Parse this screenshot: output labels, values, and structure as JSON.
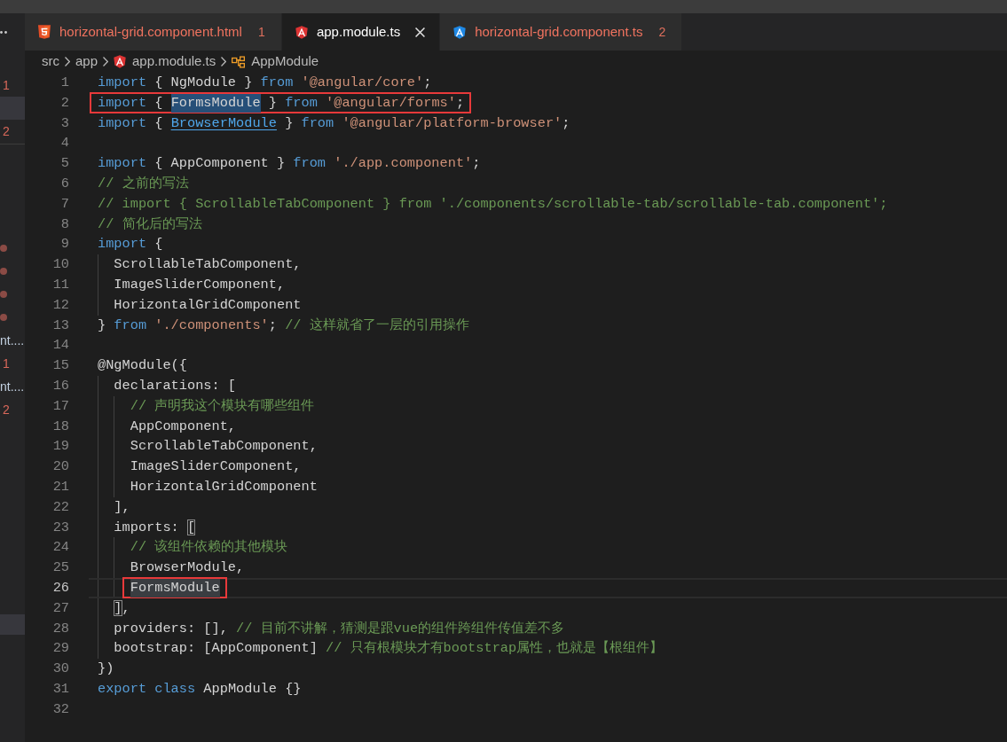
{
  "tabs": [
    {
      "kind": "html",
      "label": "horizontal-grid.component.html",
      "badge": "1",
      "selected": false
    },
    {
      "kind": "module",
      "label": "app.module.ts",
      "selected": true
    },
    {
      "kind": "component",
      "label": "horizontal-grid.component.ts",
      "badge": "2",
      "selected": false
    }
  ],
  "breadcrumbs": [
    {
      "kind": "folder",
      "text": "src"
    },
    {
      "kind": "folder",
      "text": "app"
    },
    {
      "kind": "module",
      "text": "app.module.ts"
    },
    {
      "kind": "class",
      "text": "AppModule"
    }
  ],
  "sidebar": {
    "open_editors": [
      {
        "kind": "badge",
        "text": "1",
        "selected": false
      },
      {
        "kind": "blank",
        "selected": true
      },
      {
        "kind": "badge",
        "text": "2",
        "selected": false
      }
    ],
    "files": [
      {
        "kind": "dot",
        "selected": false
      },
      {
        "kind": "dot",
        "selected": false
      },
      {
        "kind": "dot",
        "selected": false
      },
      {
        "kind": "dot",
        "selected": false
      },
      {
        "kind": "label",
        "text": "nt....",
        "selected": false
      },
      {
        "kind": "badge",
        "text": "1",
        "selected": false
      },
      {
        "kind": "label",
        "text": "nt....",
        "selected": false
      },
      {
        "kind": "badge",
        "text": "2",
        "selected": false
      }
    ],
    "bottom": [
      {
        "selected": true
      }
    ]
  },
  "editor": {
    "lines": [
      {
        "number": "1",
        "current": false,
        "boxed": false,
        "code": [
          {
            "kind": "keyword",
            "text": "import"
          },
          {
            "kind": "plain",
            "text": " { NgModule } "
          },
          {
            "kind": "keyword",
            "text": "from "
          },
          {
            "kind": "string",
            "text": "'@angular/core'"
          },
          {
            "kind": "plain",
            "text": ";"
          }
        ]
      },
      {
        "number": "2",
        "current": false,
        "boxed": true,
        "code": [
          {
            "kind": "keyword",
            "text": "import"
          },
          {
            "kind": "plain",
            "text": " { "
          },
          {
            "kind": "selection",
            "text": "FormsModule"
          },
          {
            "kind": "plain",
            "text": " } "
          },
          {
            "kind": "keyword",
            "text": "from "
          },
          {
            "kind": "string",
            "text": "'@angular/forms'"
          },
          {
            "kind": "plain",
            "text": ";"
          }
        ]
      },
      {
        "number": "3",
        "current": false,
        "boxed": false,
        "code": [
          {
            "kind": "keyword",
            "text": "import"
          },
          {
            "kind": "plain",
            "text": " { "
          },
          {
            "kind": "link",
            "text": "BrowserModule"
          },
          {
            "kind": "plain",
            "text": " } "
          },
          {
            "kind": "keyword",
            "text": "from "
          },
          {
            "kind": "string",
            "text": "'@angular/platform-browser'"
          },
          {
            "kind": "plain",
            "text": ";"
          }
        ]
      },
      {
        "number": "4",
        "current": false,
        "boxed": false
      },
      {
        "number": "5",
        "current": false,
        "boxed": false,
        "code": [
          {
            "kind": "keyword",
            "text": "import"
          },
          {
            "kind": "plain",
            "text": " { AppComponent } "
          },
          {
            "kind": "keyword",
            "text": "from "
          },
          {
            "kind": "string",
            "text": "'./app.component'"
          },
          {
            "kind": "plain",
            "text": ";"
          }
        ]
      },
      {
        "number": "6",
        "current": false,
        "boxed": false,
        "code": [
          {
            "kind": "comment",
            "text": "// 之前的写法"
          }
        ]
      },
      {
        "number": "7",
        "current": false,
        "boxed": false,
        "code": [
          {
            "kind": "comment",
            "text": "// import { ScrollableTabComponent } from './components/scrollable-tab/scrollable-tab.component';"
          }
        ]
      },
      {
        "number": "8",
        "current": false,
        "boxed": false,
        "code": [
          {
            "kind": "comment",
            "text": "// 简化后的写法"
          }
        ]
      },
      {
        "number": "9",
        "current": false,
        "boxed": false,
        "code": [
          {
            "kind": "keyword",
            "text": "import"
          },
          {
            "kind": "plain",
            "text": " {"
          }
        ]
      },
      {
        "number": "10",
        "current": false,
        "boxed": false,
        "code": [
          {
            "kind": "plain",
            "text": "  ScrollableTabComponent,"
          }
        ]
      },
      {
        "number": "11",
        "current": false,
        "boxed": false,
        "code": [
          {
            "kind": "plain",
            "text": "  ImageSliderComponent,"
          }
        ]
      },
      {
        "number": "12",
        "current": false,
        "boxed": false,
        "code": [
          {
            "kind": "plain",
            "text": "  HorizontalGridComponent"
          }
        ]
      },
      {
        "number": "13",
        "current": false,
        "boxed": false,
        "code": [
          {
            "kind": "plain",
            "text": "} "
          },
          {
            "kind": "keyword",
            "text": "from "
          },
          {
            "kind": "string",
            "text": "'./components'"
          },
          {
            "kind": "plain",
            "text": "; "
          },
          {
            "kind": "comment",
            "text": "// 这样就省了一层的引用操作"
          }
        ]
      },
      {
        "number": "14",
        "current": false,
        "boxed": false
      },
      {
        "number": "15",
        "current": false,
        "boxed": false,
        "code": [
          {
            "kind": "plain",
            "text": "@NgModule({"
          }
        ]
      },
      {
        "number": "16",
        "current": false,
        "boxed": false,
        "code": [
          {
            "kind": "plain",
            "text": "  declarations: ["
          }
        ]
      },
      {
        "number": "17",
        "current": false,
        "boxed": false,
        "code": [
          {
            "kind": "comment",
            "text": "    // 声明我这个模块有哪些组件"
          }
        ]
      },
      {
        "number": "18",
        "current": false,
        "boxed": false,
        "code": [
          {
            "kind": "plain",
            "text": "    AppComponent,"
          }
        ]
      },
      {
        "number": "19",
        "current": false,
        "boxed": false,
        "code": [
          {
            "kind": "plain",
            "text": "    ScrollableTabComponent,"
          }
        ]
      },
      {
        "number": "20",
        "current": false,
        "boxed": false,
        "code": [
          {
            "kind": "plain",
            "text": "    ImageSliderComponent,"
          }
        ]
      },
      {
        "number": "21",
        "current": false,
        "boxed": false,
        "code": [
          {
            "kind": "plain",
            "text": "    HorizontalGridComponent"
          }
        ]
      },
      {
        "number": "22",
        "current": false,
        "boxed": false,
        "code": [
          {
            "kind": "plain",
            "text": "  ],"
          }
        ]
      },
      {
        "number": "23",
        "current": false,
        "boxed": false,
        "code": [
          {
            "kind": "plain",
            "text": "  imports: "
          },
          {
            "kind": "bracket",
            "text": "["
          }
        ]
      },
      {
        "number": "24",
        "current": false,
        "boxed": false,
        "code": [
          {
            "kind": "comment",
            "text": "    // 该组件依赖的其他模块"
          }
        ]
      },
      {
        "number": "25",
        "current": false,
        "boxed": false,
        "code": [
          {
            "kind": "plain",
            "text": "    BrowserModule,"
          }
        ]
      },
      {
        "number": "26",
        "current": true,
        "boxed": true,
        "code": [
          {
            "kind": "match",
            "text": "    FormsModule"
          }
        ]
      },
      {
        "number": "27",
        "current": false,
        "boxed": false,
        "code": [
          {
            "kind": "bracket",
            "text": "  ]"
          },
          {
            "kind": "plain",
            "text": ","
          }
        ]
      },
      {
        "number": "28",
        "current": false,
        "boxed": false,
        "code": [
          {
            "kind": "plain",
            "text": "  providers: [], "
          },
          {
            "kind": "comment",
            "text": "// 目前不讲解，猜测是跟vue的组件跨组件传值差不多"
          }
        ]
      },
      {
        "number": "29",
        "current": false,
        "boxed": false,
        "code": [
          {
            "kind": "plain",
            "text": "  bootstrap: [AppComponent] "
          },
          {
            "kind": "comment",
            "text": "// 只有根模块才有bootstrap属性，也就是【根组件】"
          }
        ]
      },
      {
        "number": "30",
        "current": false,
        "boxed": false,
        "code": [
          {
            "kind": "plain",
            "text": "})"
          }
        ]
      },
      {
        "number": "31",
        "current": false,
        "boxed": false,
        "code": [
          {
            "kind": "keyword",
            "text": "export class "
          },
          {
            "kind": "plain",
            "text": "AppModule {}"
          }
        ]
      },
      {
        "number": "32",
        "current": false,
        "boxed": false
      }
    ]
  }
}
